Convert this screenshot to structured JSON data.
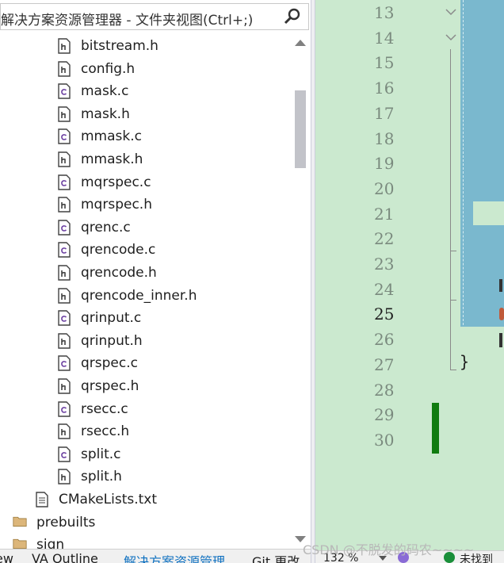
{
  "explorer": {
    "search_placeholder": "解决方案资源管理器 - 文件夹视图(Ctrl+;)",
    "files": [
      {
        "name": "bitstream.h",
        "type": "h"
      },
      {
        "name": "config.h",
        "type": "h"
      },
      {
        "name": "mask.c",
        "type": "c"
      },
      {
        "name": "mask.h",
        "type": "h"
      },
      {
        "name": "mmask.c",
        "type": "c"
      },
      {
        "name": "mmask.h",
        "type": "h"
      },
      {
        "name": "mqrspec.c",
        "type": "c"
      },
      {
        "name": "mqrspec.h",
        "type": "h"
      },
      {
        "name": "qrenc.c",
        "type": "c"
      },
      {
        "name": "qrencode.c",
        "type": "c"
      },
      {
        "name": "qrencode.h",
        "type": "h"
      },
      {
        "name": "qrencode_inner.h",
        "type": "h"
      },
      {
        "name": "qrinput.c",
        "type": "c"
      },
      {
        "name": "qrinput.h",
        "type": "h"
      },
      {
        "name": "qrspec.c",
        "type": "c"
      },
      {
        "name": "qrspec.h",
        "type": "h"
      },
      {
        "name": "rsecc.c",
        "type": "c"
      },
      {
        "name": "rsecc.h",
        "type": "h"
      },
      {
        "name": "split.c",
        "type": "c"
      },
      {
        "name": "split.h",
        "type": "h"
      }
    ],
    "cmakelists": "CMakeLists.txt",
    "folders": [
      "prebuilts",
      "sign"
    ],
    "bottom_tabs": [
      "ew",
      "VA Outline",
      "解决方案资源管理",
      "Git 更改"
    ]
  },
  "editor": {
    "line_numbers": [
      "13",
      "14",
      "15",
      "16",
      "17",
      "18",
      "19",
      "20",
      "21",
      "22",
      "23",
      "24",
      "25",
      "26",
      "27",
      "28",
      "29",
      "30"
    ],
    "current_line": "25",
    "closing_brace": "}",
    "background": "#cbe9cf",
    "selection_color": "#7ab8ce",
    "change_bar_color": "#107c10"
  },
  "status_bar": {
    "zoom": "132 %",
    "status_text": "未找到"
  },
  "watermark": "CSDN @不脱发的码农~~~~"
}
